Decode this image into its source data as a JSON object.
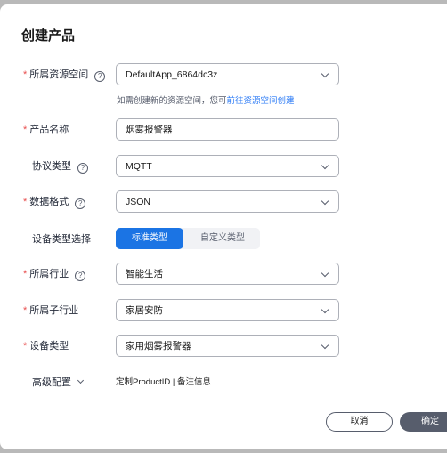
{
  "dialog": {
    "title": "创建产品",
    "required_mark": "*",
    "help_glyph": "?",
    "fields": {
      "resource_space": {
        "label": "所属资源空间",
        "value": "DefaultApp_6864dc3z"
      },
      "product_name": {
        "label": "产品名称",
        "value": "烟雾报警器"
      },
      "protocol": {
        "label": "协议类型",
        "value": "MQTT"
      },
      "data_format": {
        "label": "数据格式",
        "value": "JSON"
      },
      "device_type_select": {
        "label": "设备类型选择",
        "options": [
          "标准类型",
          "自定义类型"
        ],
        "selected": "标准类型"
      },
      "industry": {
        "label": "所属行业",
        "value": "智能生活"
      },
      "sub_industry": {
        "label": "所属子行业",
        "value": "家居安防"
      },
      "device_type": {
        "label": "设备类型",
        "value": "家用烟雾报警器"
      },
      "advanced": {
        "label": "高级配置",
        "summary": "定制ProductID | 备注信息"
      }
    },
    "hint": {
      "text": "如需创建新的资源空间，您可",
      "link": "前往资源空间创建"
    },
    "buttons": {
      "cancel": "取消",
      "confirm": "确定"
    }
  }
}
